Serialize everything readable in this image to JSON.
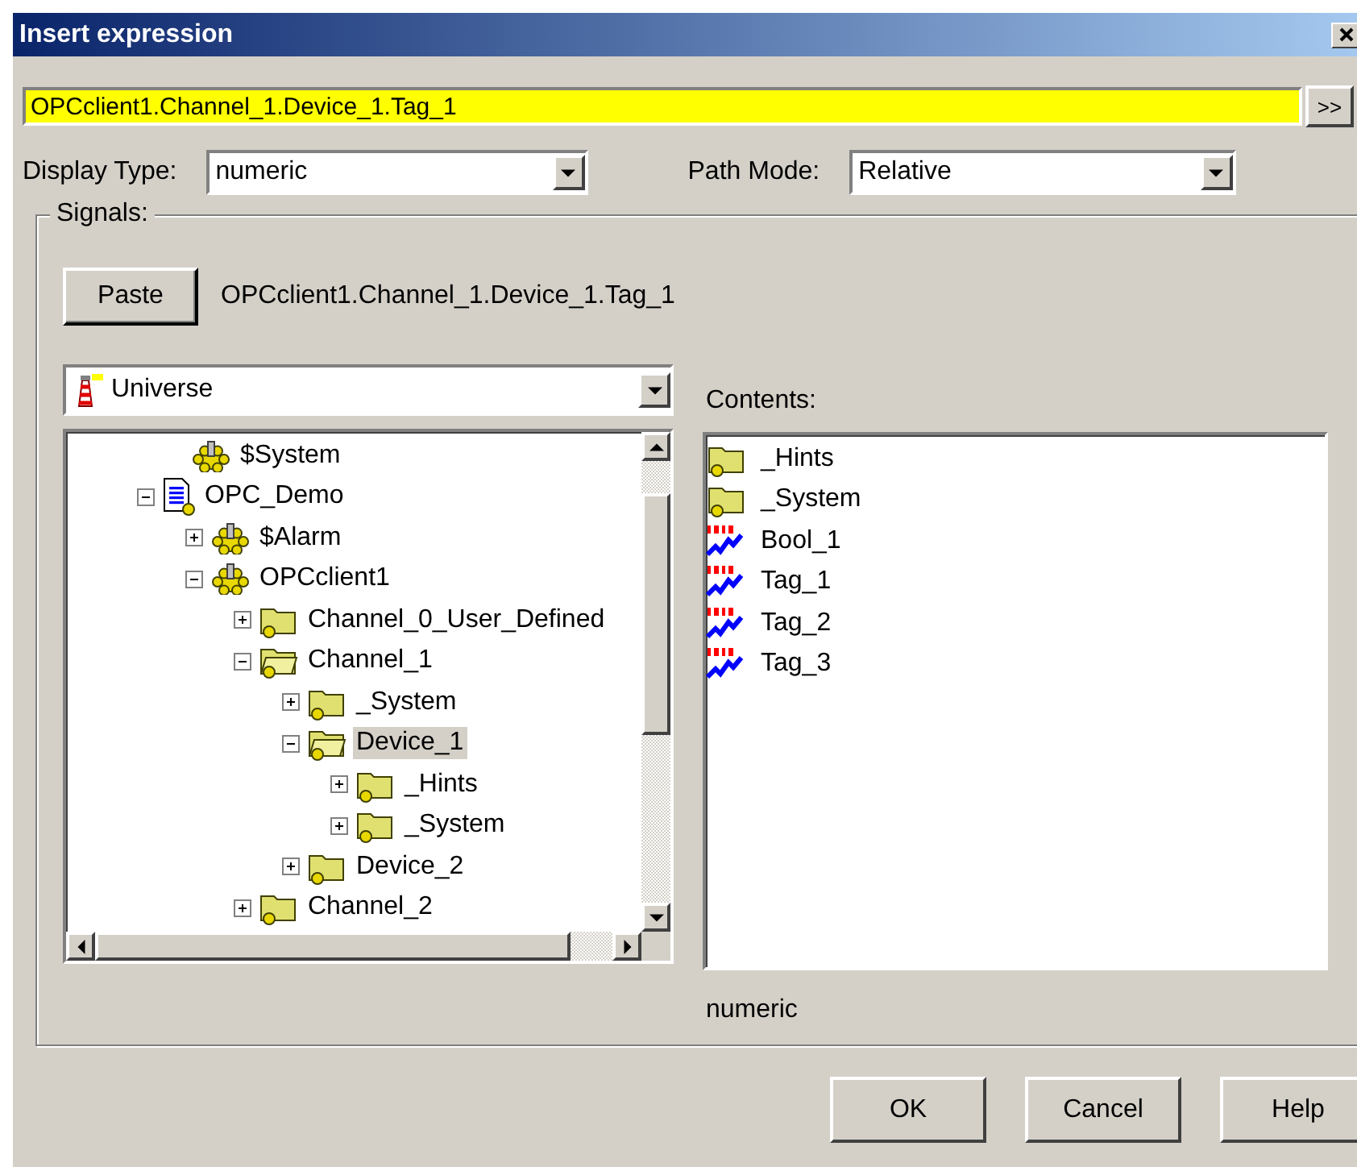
{
  "window": {
    "title": "Insert expression"
  },
  "expression": {
    "value": "OPCclient1.Channel_1.Device_1.Tag_1",
    "expand_button": ">>"
  },
  "display_type": {
    "label": "Display Type:",
    "value": "numeric"
  },
  "path_mode": {
    "label": "Path Mode:",
    "value": "Relative"
  },
  "signals": {
    "title": "Signals:",
    "paste_button": "Paste",
    "paste_path": "OPCclient1.Channel_1.Device_1.Tag_1",
    "root_selector": "Universe",
    "tree": [
      {
        "label": "$System",
        "kind": "gear"
      },
      {
        "label": "OPC_Demo",
        "kind": "project",
        "expanded": true,
        "selected": false,
        "children": [
          {
            "label": "$Alarm",
            "kind": "gear",
            "expanded": false,
            "selected": false
          },
          {
            "label": "OPCclient1",
            "kind": "gear",
            "expanded": true,
            "selected": false,
            "children": [
              {
                "label": "Channel_0_User_Defined",
                "kind": "folder",
                "expanded": false,
                "selected": false
              },
              {
                "label": "Channel_1",
                "kind": "folder",
                "expanded": true,
                "selected": false,
                "children": [
                  {
                    "label": "_System",
                    "kind": "folder",
                    "expanded": false,
                    "selected": false
                  },
                  {
                    "label": "Device_1",
                    "kind": "folder",
                    "expanded": true,
                    "selected": true,
                    "children": [
                      {
                        "label": "_Hints",
                        "kind": "folder",
                        "expanded": false,
                        "selected": false
                      },
                      {
                        "label": "_System",
                        "kind": "folder",
                        "expanded": false,
                        "selected": false
                      }
                    ]
                  },
                  {
                    "label": "Device_2",
                    "kind": "folder",
                    "expanded": false,
                    "selected": false
                  }
                ]
              },
              {
                "label": "Channel_2",
                "kind": "folder",
                "expanded": false,
                "selected": false
              }
            ]
          }
        ]
      }
    ],
    "contents_label": "Contents:",
    "contents": [
      {
        "label": "_Hints",
        "kind": "folder"
      },
      {
        "label": "_System",
        "kind": "folder"
      },
      {
        "label": "Bool_1",
        "kind": "signal"
      },
      {
        "label": "Tag_1",
        "kind": "signal"
      },
      {
        "label": "Tag_2",
        "kind": "signal"
      },
      {
        "label": "Tag_3",
        "kind": "signal"
      }
    ],
    "type_text": "numeric"
  },
  "buttons": [
    "OK",
    "Cancel",
    "Help"
  ]
}
